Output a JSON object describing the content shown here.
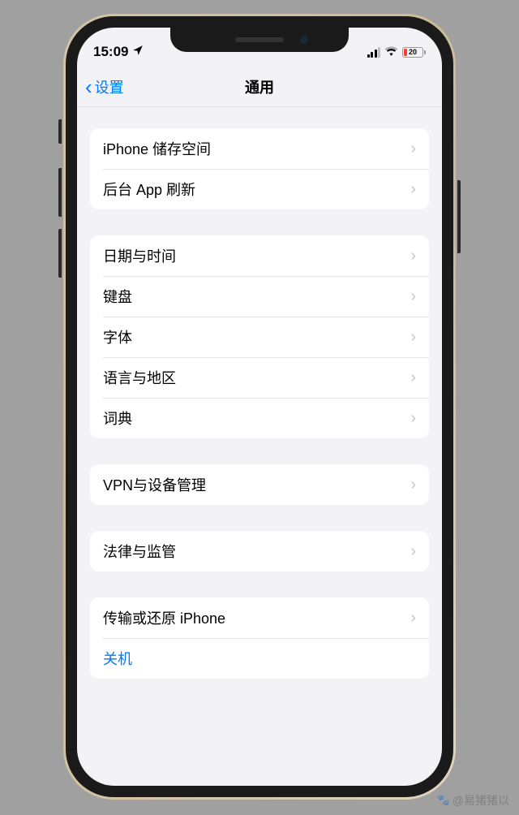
{
  "status": {
    "time": "15:09",
    "battery_percent": "20"
  },
  "nav": {
    "back_label": "设置",
    "title": "通用"
  },
  "groups": [
    {
      "rows": [
        {
          "label": "iPhone 储存空间",
          "chevron": true
        },
        {
          "label": "后台 App 刷新",
          "chevron": true
        }
      ]
    },
    {
      "rows": [
        {
          "label": "日期与时间",
          "chevron": true
        },
        {
          "label": "键盘",
          "chevron": true
        },
        {
          "label": "字体",
          "chevron": true
        },
        {
          "label": "语言与地区",
          "chevron": true
        },
        {
          "label": "词典",
          "chevron": true
        }
      ]
    },
    {
      "highlighted": true,
      "rows": [
        {
          "label": "VPN与设备管理",
          "chevron": true
        }
      ]
    },
    {
      "rows": [
        {
          "label": "法律与监管",
          "chevron": true
        }
      ]
    },
    {
      "rows": [
        {
          "label": "传输或还原 iPhone",
          "chevron": true
        },
        {
          "label": "关机",
          "chevron": false,
          "blue": true
        }
      ]
    }
  ],
  "watermark": "@易猪猪以"
}
